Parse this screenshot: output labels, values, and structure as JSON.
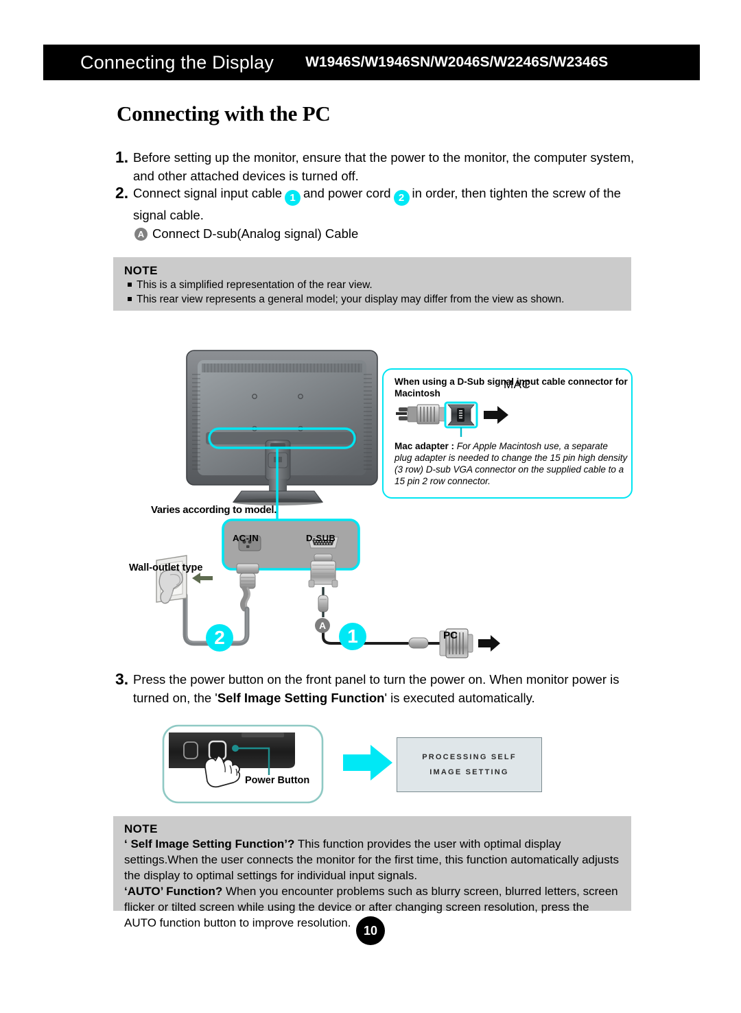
{
  "header": {
    "title": "Connecting the Display",
    "models": "W1946S/W1946SN/W2046S/W2246S/W2346S"
  },
  "section": {
    "heading": "Connecting with the PC"
  },
  "steps": [
    {
      "number": "1.",
      "text": "Before setting up the monitor, ensure that the power to the monitor, the computer system, and other attached devices is turned off."
    },
    {
      "number": "2.",
      "text_part1": "Connect signal input cable",
      "badge1": "1",
      "text_part2": "and power cord",
      "badge2": "2",
      "text_part3": "in order, then tighten the screw of the signal cable."
    },
    {
      "number": "3.",
      "text_part1": "Press the power button on the front panel to turn the power on. When monitor power is turned on, the '",
      "bold": "Self Image Setting Function",
      "text_part2": "' is executed automatically."
    }
  ],
  "sub_item": {
    "badge": "A",
    "label": "Connect D-sub(Analog signal) Cable"
  },
  "note_top": {
    "title": "NOTE",
    "bullets": [
      "This is a simplified representation of the rear view.",
      "This rear view represents a general model; your display may differ from the view as shown."
    ]
  },
  "note_bottom": {
    "title": "NOTE",
    "para1_bold": "‘ Self Image Setting Function’?",
    "para1_rest": " This function provides the user with optimal display settings.When the user connects the monitor for the first time, this function automatically adjusts the display to optimal settings for individual input signals.",
    "para2_bold": "‘AUTO’ Function?",
    "para2_rest": " When you encounter problems such as blurry screen, blurred letters, screen flicker or tilted screen while using the device or after changing screen resolution, press the AUTO function button to improve resolution."
  },
  "mac_callout": {
    "title": "When using a D-Sub signal input cable connector for Macintosh",
    "mac_label": "MAC",
    "desc_bold": "Mac adapter :",
    "desc_italic": " For Apple Macintosh use, a separate plug adapter is needed to change the 15 pin high density (3 row) D-sub VGA connector on the supplied cable to a 15 pin  2 row connector."
  },
  "diagram": {
    "label_varies": "Varies according to model.",
    "label_wall_outlet": "Wall-outlet type",
    "label_pc": "PC",
    "port_ac_in": "AC-IN",
    "port_d_sub": "D-SUB",
    "badge_power": "2",
    "badge_signal": "1",
    "badge_a": "A"
  },
  "power_section": {
    "label_power_button": "Power Button",
    "osd_line1": "PROCESSING SELF",
    "osd_line2": "IMAGE SETTING"
  },
  "page_number": "10",
  "colors": {
    "cyan": "#00e8f5",
    "header_bg": "#000000",
    "note_bg": "#cbcbcb",
    "osd_bg": "#dfe6e9",
    "badge_gray": "#808080"
  }
}
